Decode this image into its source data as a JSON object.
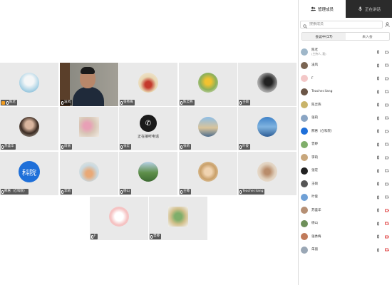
{
  "panel": {
    "tabs": [
      {
        "label": "管理成员",
        "icon": "people-icon"
      },
      {
        "label": "正在讲话",
        "icon": "mic-icon"
      }
    ],
    "search_placeholder": "搜索成员",
    "segments": [
      "会议中(17)",
      "未入会"
    ]
  },
  "tiles": [
    {
      "name": "陈老",
      "avatar": "photo-beach",
      "host": true
    },
    {
      "name": "凌风",
      "avatar": "camera-video"
    },
    {
      "name": "张秀梅",
      "avatar": "photo-tulip-red"
    },
    {
      "name": "陈灵燕",
      "avatar": "photo-tulip-yellow"
    },
    {
      "name": "王硕",
      "avatar": "photo-bw-figure"
    },
    {
      "name": "苏盛华",
      "avatar": "photo-girl"
    },
    {
      "name": "周丽",
      "avatar": "photo-flowers",
      "square": true
    },
    {
      "name": "张宏",
      "avatar": "phone-icon",
      "phone_label": "正在接听电话"
    },
    {
      "name": "张莉",
      "avatar": "photo-coast"
    },
    {
      "name": "叶俊",
      "avatar": "photo-sea"
    },
    {
      "name": "邢惠（仓科院）",
      "avatar_text": "科院"
    },
    {
      "name": "李莉",
      "avatar": "photo-room"
    },
    {
      "name": "杨山",
      "avatar": "photo-mountain"
    },
    {
      "name": "王莓",
      "avatar": "photo-cartoon-girl"
    },
    {
      "name": "Teacher.liang",
      "avatar": "photo-cafe"
    },
    {
      "name": "F",
      "avatar": "photo-cartoon-pink"
    },
    {
      "name": "曾婷",
      "avatar": "photo-cartoon-plant",
      "square": true
    }
  ],
  "members": [
    {
      "name": "陈老",
      "sub": "(主持人, 我)",
      "color": "#9fb7c9",
      "mic_muted": false,
      "cam_off": false
    },
    {
      "name": "凌风",
      "color": "#7a6552",
      "mic_muted": false,
      "cam_off": false
    },
    {
      "name": "F",
      "color": "#f3c7c7",
      "mic_muted": false,
      "cam_off": false
    },
    {
      "name": "Teacher.liang",
      "color": "#6b5647",
      "mic_muted": false,
      "cam_off": false
    },
    {
      "name": "陈灵燕",
      "color": "#c9b46a",
      "mic_muted": false,
      "cam_off": false
    },
    {
      "name": "张莉",
      "color": "#8aa5c4",
      "mic_muted": false,
      "cam_off": false
    },
    {
      "name": "邢惠（仓科院）",
      "color": "#1e6fd9",
      "mic_muted": false,
      "cam_off": false
    },
    {
      "name": "曾婷",
      "color": "#7fae6a",
      "mic_muted": false,
      "cam_off": false
    },
    {
      "name": "李莉",
      "color": "#c8a77c",
      "mic_muted": false,
      "cam_off": false
    },
    {
      "name": "张宏",
      "color": "#222222",
      "mic_muted": false,
      "cam_off": false
    },
    {
      "name": "王硕",
      "color": "#555555",
      "mic_muted": false,
      "cam_off": false
    },
    {
      "name": "叶俊",
      "color": "#6fa0d6",
      "mic_muted": false,
      "cam_off": false
    },
    {
      "name": "苏盛华",
      "color": "#b58f74",
      "mic_muted": false,
      "cam_off": true
    },
    {
      "name": "杨山",
      "color": "#6e8f5a",
      "mic_muted": false,
      "cam_off": true
    },
    {
      "name": "张秀梅",
      "color": "#c07a5a",
      "mic_muted": false,
      "cam_off": true
    },
    {
      "name": "朱丽",
      "color": "#9aa7b5",
      "mic_muted": false,
      "cam_off": true
    }
  ]
}
